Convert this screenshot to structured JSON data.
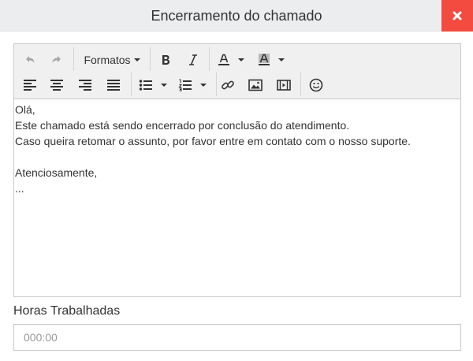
{
  "dialog": {
    "title": "Encerramento do chamado",
    "close_icon": "close-x-icon",
    "close_color": "#f34b3f"
  },
  "toolbar": {
    "row1": [
      {
        "name": "undo",
        "icon": "undo-icon",
        "enabled": false
      },
      {
        "name": "redo",
        "icon": "redo-icon",
        "enabled": false
      },
      {
        "name": "formats",
        "label": "Formatos",
        "icon": "chevron-down-icon"
      },
      {
        "name": "bold",
        "icon": "bold-icon"
      },
      {
        "name": "italic",
        "icon": "italic-icon"
      },
      {
        "name": "text-color",
        "icon": "text-color-icon"
      },
      {
        "name": "background-color",
        "icon": "background-color-icon"
      }
    ],
    "row2": [
      {
        "name": "align-left",
        "icon": "align-left-icon"
      },
      {
        "name": "align-center",
        "icon": "align-center-icon"
      },
      {
        "name": "align-right",
        "icon": "align-right-icon"
      },
      {
        "name": "align-justify",
        "icon": "align-justify-icon"
      },
      {
        "name": "bullet-list",
        "icon": "bullet-list-icon"
      },
      {
        "name": "numbered-list",
        "icon": "numbered-list-icon"
      },
      {
        "name": "link",
        "icon": "link-icon"
      },
      {
        "name": "image",
        "icon": "image-icon"
      },
      {
        "name": "media",
        "icon": "media-icon"
      },
      {
        "name": "emoticons",
        "icon": "smiley-icon"
      }
    ]
  },
  "editor": {
    "lines": [
      "Olá,",
      "Este chamado está sendo encerrado por conclusão do atendimento.",
      "Caso queira retomar o assunto, por favor entre em contato com o nosso suporte.",
      "",
      "Atenciosamente,",
      "..."
    ]
  },
  "hours": {
    "label": "Horas Trabalhadas",
    "placeholder": "000:00",
    "value": ""
  }
}
